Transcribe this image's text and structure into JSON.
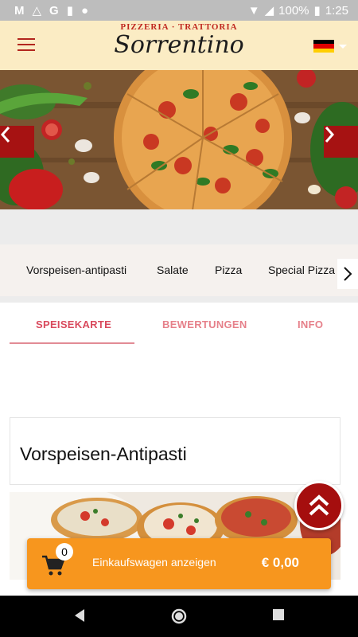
{
  "status_bar": {
    "left_icons": [
      "gmail-icon",
      "drive-icon",
      "google-icon",
      "sd-card-icon",
      "circle-icon"
    ],
    "battery": "100%",
    "time": "1:25"
  },
  "header": {
    "brand_tagline": "PIZZERIA · TRATTORIA",
    "brand_name": "Sorrentino",
    "language_flag": "germany-flag-icon"
  },
  "category_nav": {
    "items": [
      "Vorspeisen-antipasti",
      "Salate",
      "Pizza",
      "Special Pizza"
    ]
  },
  "tabs": [
    {
      "label": "SPEISEKARTE",
      "active": true
    },
    {
      "label": "BEWERTUNGEN",
      "active": false
    },
    {
      "label": "INFO",
      "active": false
    }
  ],
  "section": {
    "title": "Vorspeisen-Antipasti"
  },
  "cart": {
    "count": "0",
    "label": "Einkaufswagen anzeigen",
    "total": "€ 0,00"
  },
  "colors": {
    "header_bg": "#fbecc4",
    "brand_red": "#a61212",
    "tab_active": "#d94a5d",
    "cart_orange": "#f7961e"
  }
}
